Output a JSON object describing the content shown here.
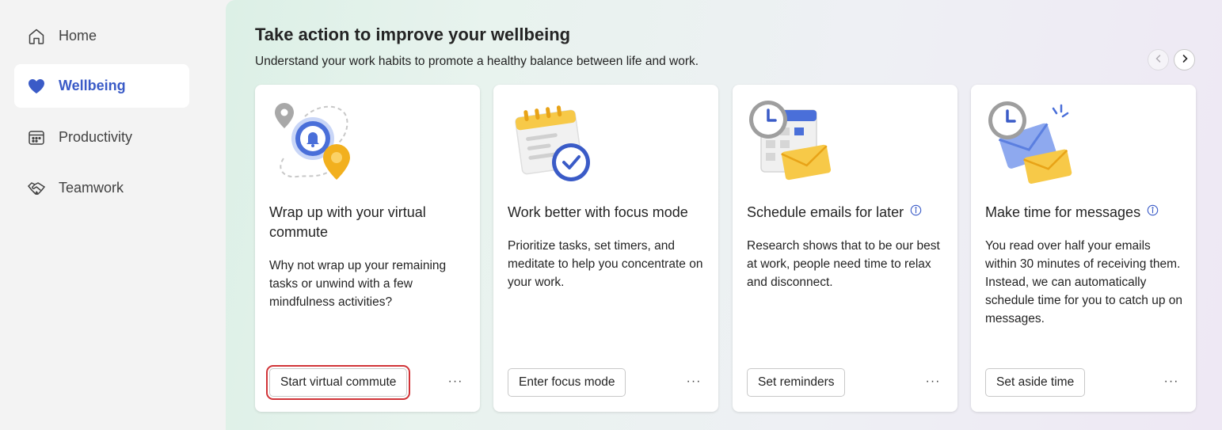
{
  "sidebar": {
    "items": [
      {
        "label": "Home",
        "icon": "home-icon",
        "active": false
      },
      {
        "label": "Wellbeing",
        "icon": "heart-icon",
        "active": true
      },
      {
        "label": "Productivity",
        "icon": "calendar-grid-icon",
        "active": false
      },
      {
        "label": "Teamwork",
        "icon": "handshake-icon",
        "active": false
      }
    ]
  },
  "main": {
    "title": "Take action to improve your wellbeing",
    "subtitle": "Understand your work habits to promote a healthy balance between life and work.",
    "pager": {
      "prev_icon": "chevron-left-icon",
      "next_icon": "chevron-right-icon"
    },
    "cards": [
      {
        "title": "Wrap up with your virtual commute",
        "description": "Why not wrap up your remaining tasks or unwind with a few mindfulness activities?",
        "button": "Start virtual commute",
        "more": "···",
        "illustration": "commute-map-pin-bell-illustration"
      },
      {
        "title": "Work better with focus mode",
        "description": "Prioritize tasks, set timers, and meditate to help you concentrate on your work.",
        "button": "Enter focus mode",
        "more": "···",
        "illustration": "calendar-checkmark-illustration"
      },
      {
        "title": "Schedule emails for later",
        "description": "Research shows that to be our best at work, people need time to relax and disconnect.",
        "button": "Set reminders",
        "more": "···",
        "illustration": "clock-calendar-envelope-illustration"
      },
      {
        "title": "Make time for messages",
        "description": "You read over half your emails within 30 minutes of receiving them. Instead, we can automatically schedule time for you to catch up on messages.",
        "button": "Set aside time",
        "more": "···",
        "illustration": "clock-envelopes-illustration"
      }
    ]
  },
  "colors": {
    "accent": "#3a5bc7",
    "highlight_outline": "#d13438"
  }
}
